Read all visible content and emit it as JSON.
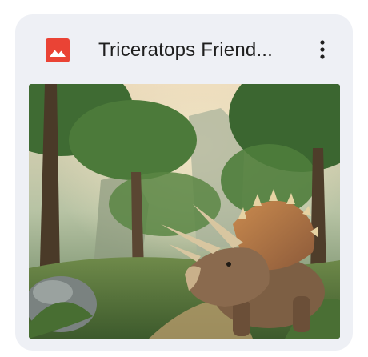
{
  "file_card": {
    "title": "Triceratops Friend...",
    "file_type_icon": "image-file-icon",
    "menu_icon": "more-vert-icon",
    "thumbnail_subject": "triceratops-in-forest-image"
  },
  "colors": {
    "card_background": "#eef0f5",
    "icon_red": "#ea4335",
    "title_text": "#1f1f1f",
    "menu_dots": "#1f1f1f"
  }
}
